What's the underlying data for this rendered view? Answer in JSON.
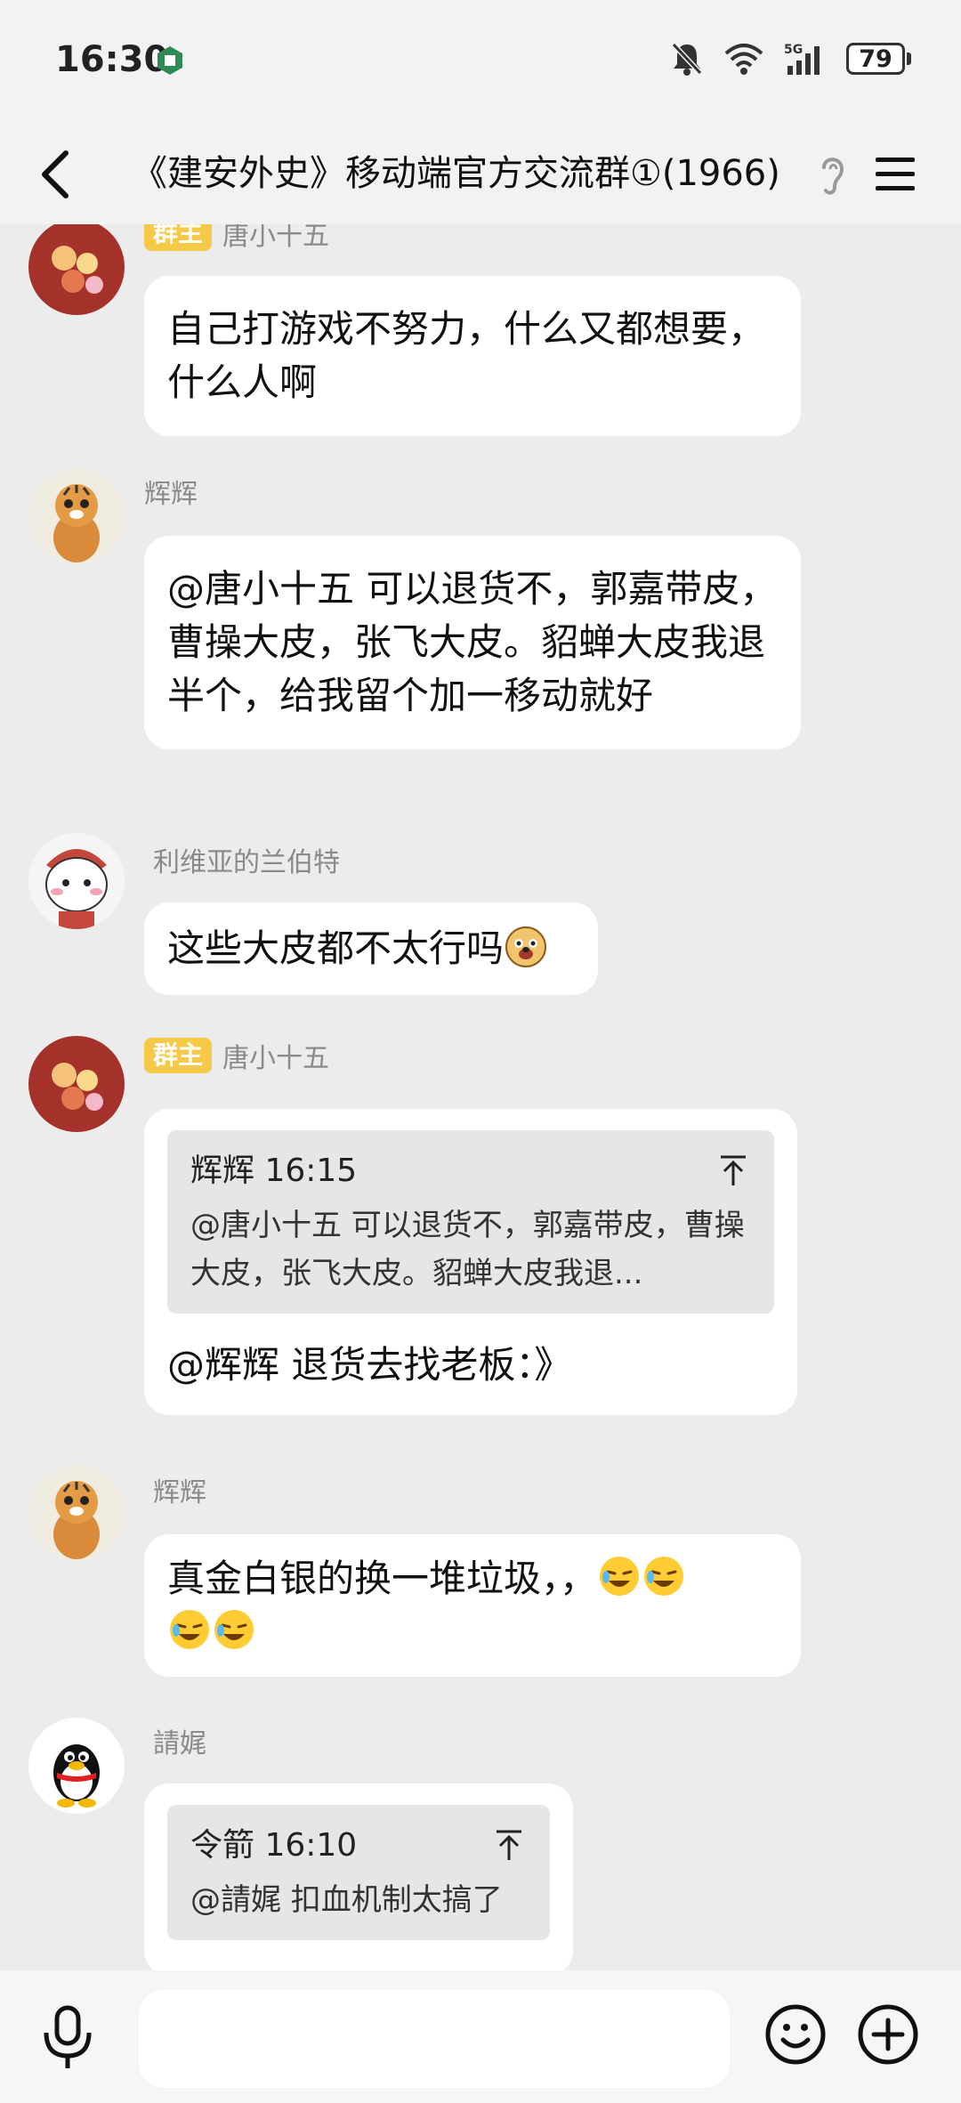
{
  "status_bar": {
    "time": "16:30",
    "battery": "79"
  },
  "header": {
    "title": "《建安外史》移动端官方交流群①(1966)"
  },
  "messages": [
    {
      "sender": "唐小十五",
      "badge": "群主",
      "text": "自己打游戏不努力，什么又都想要，什么人啊"
    },
    {
      "sender": "辉辉",
      "text": "@唐小十五 可以退货不，郭嘉带皮，曹操大皮，张飞大皮。貂蝉大皮我退半个，给我留个加一移动就好"
    },
    {
      "sender": "利维亚的兰伯特",
      "text": "这些大皮都不太行吗"
    },
    {
      "sender": "唐小十五",
      "badge": "群主",
      "quote_head": "辉辉 16:15",
      "quote_body": "@唐小十五 可以退货不，郭嘉带皮，曹操大皮，张飞大皮。貂蝉大皮我退...",
      "text": "@辉辉 退货去找老板：》"
    },
    {
      "sender": "辉辉",
      "text": "真金白银的换一堆垃圾，，"
    },
    {
      "sender": "請娓",
      "quote_head": "令箭 16:10",
      "quote_body": "@請娓 扣血机制太搞了"
    }
  ],
  "input": {
    "placeholder": ""
  },
  "icons": {
    "back": "back-arrow-icon",
    "ear": "ear-icon",
    "menu": "menu-icon",
    "mic": "microphone-icon",
    "emoji": "smiley-icon",
    "plus": "plus-circle-icon"
  }
}
